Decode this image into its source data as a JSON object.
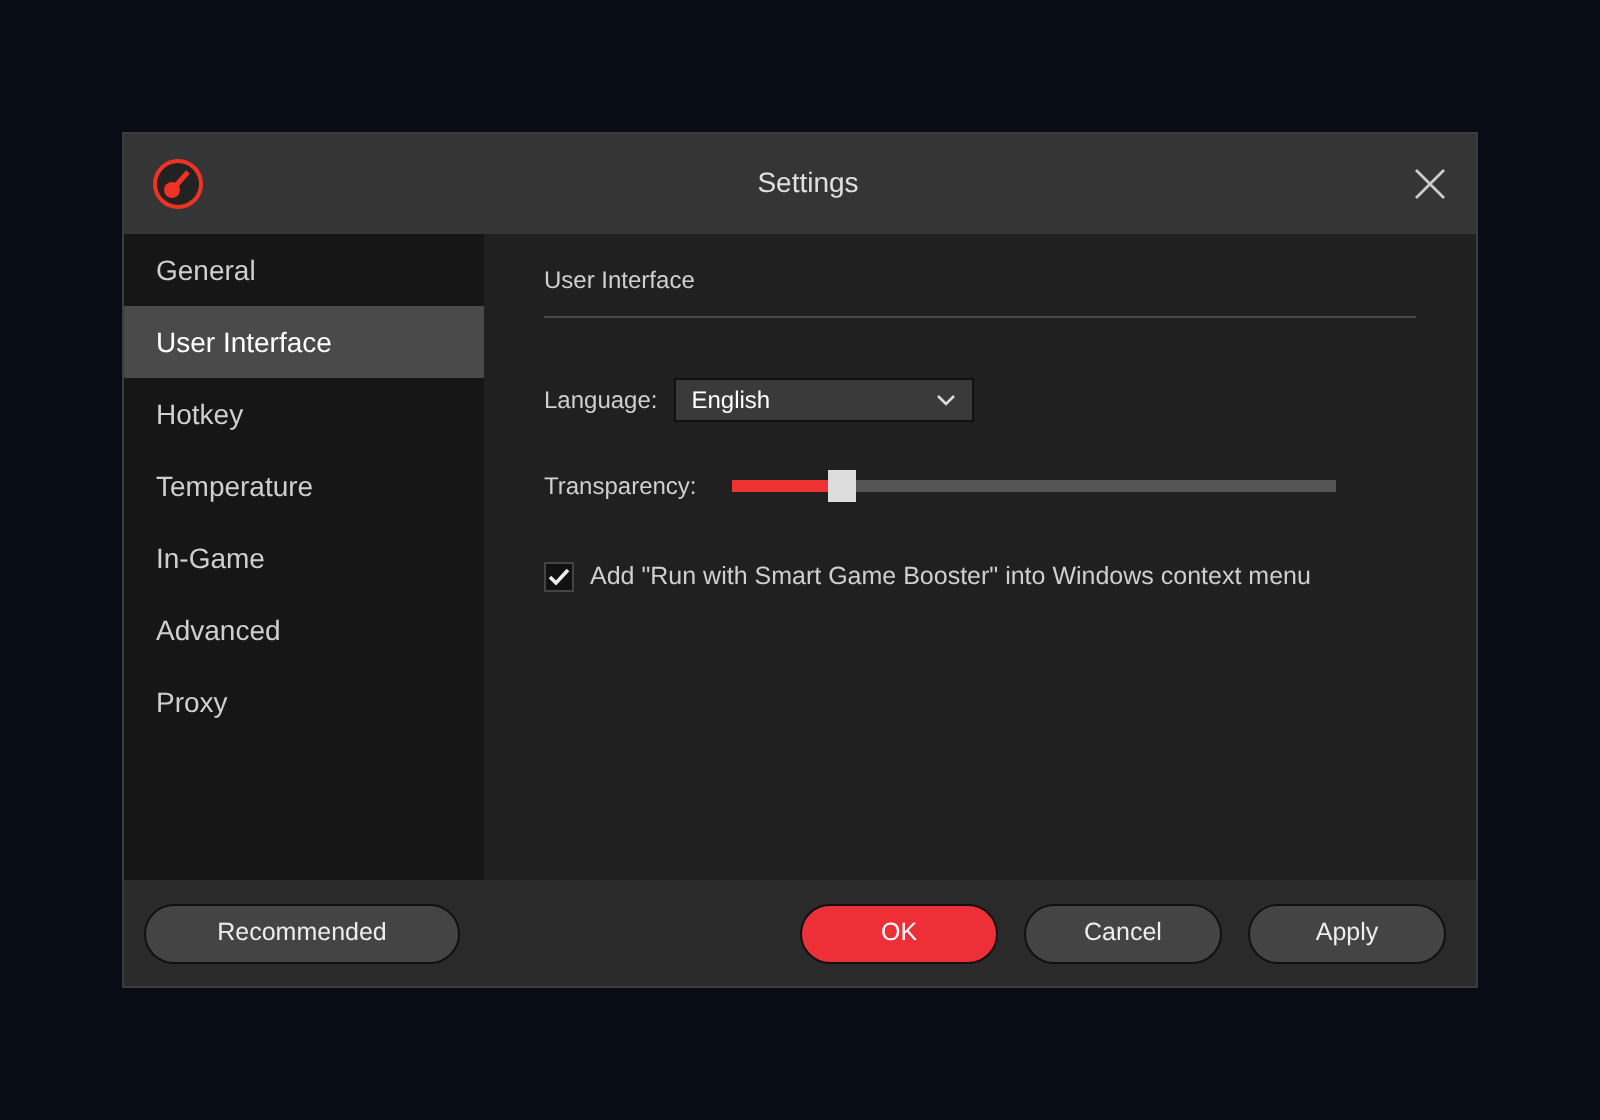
{
  "dialog": {
    "title": "Settings"
  },
  "sidebar": {
    "items": [
      {
        "label": "General",
        "selected": false
      },
      {
        "label": "User Interface",
        "selected": true
      },
      {
        "label": "Hotkey",
        "selected": false
      },
      {
        "label": "Temperature",
        "selected": false
      },
      {
        "label": "In-Game",
        "selected": false
      },
      {
        "label": "Advanced",
        "selected": false
      },
      {
        "label": "Proxy",
        "selected": false
      }
    ]
  },
  "panel": {
    "heading": "User Interface",
    "language": {
      "label": "Language:",
      "value": "English"
    },
    "transparency": {
      "label": "Transparency:",
      "level": 0.18
    },
    "context_menu": {
      "label": "Add \"Run with Smart Game Booster\" into Windows context menu",
      "checked": true
    }
  },
  "footer": {
    "buttons": [
      {
        "label": "Recommended",
        "kind": "plain"
      },
      {
        "label": "OK",
        "kind": "primary"
      },
      {
        "label": "Cancel",
        "kind": "plain"
      },
      {
        "label": "Apply",
        "kind": "plain"
      }
    ]
  }
}
